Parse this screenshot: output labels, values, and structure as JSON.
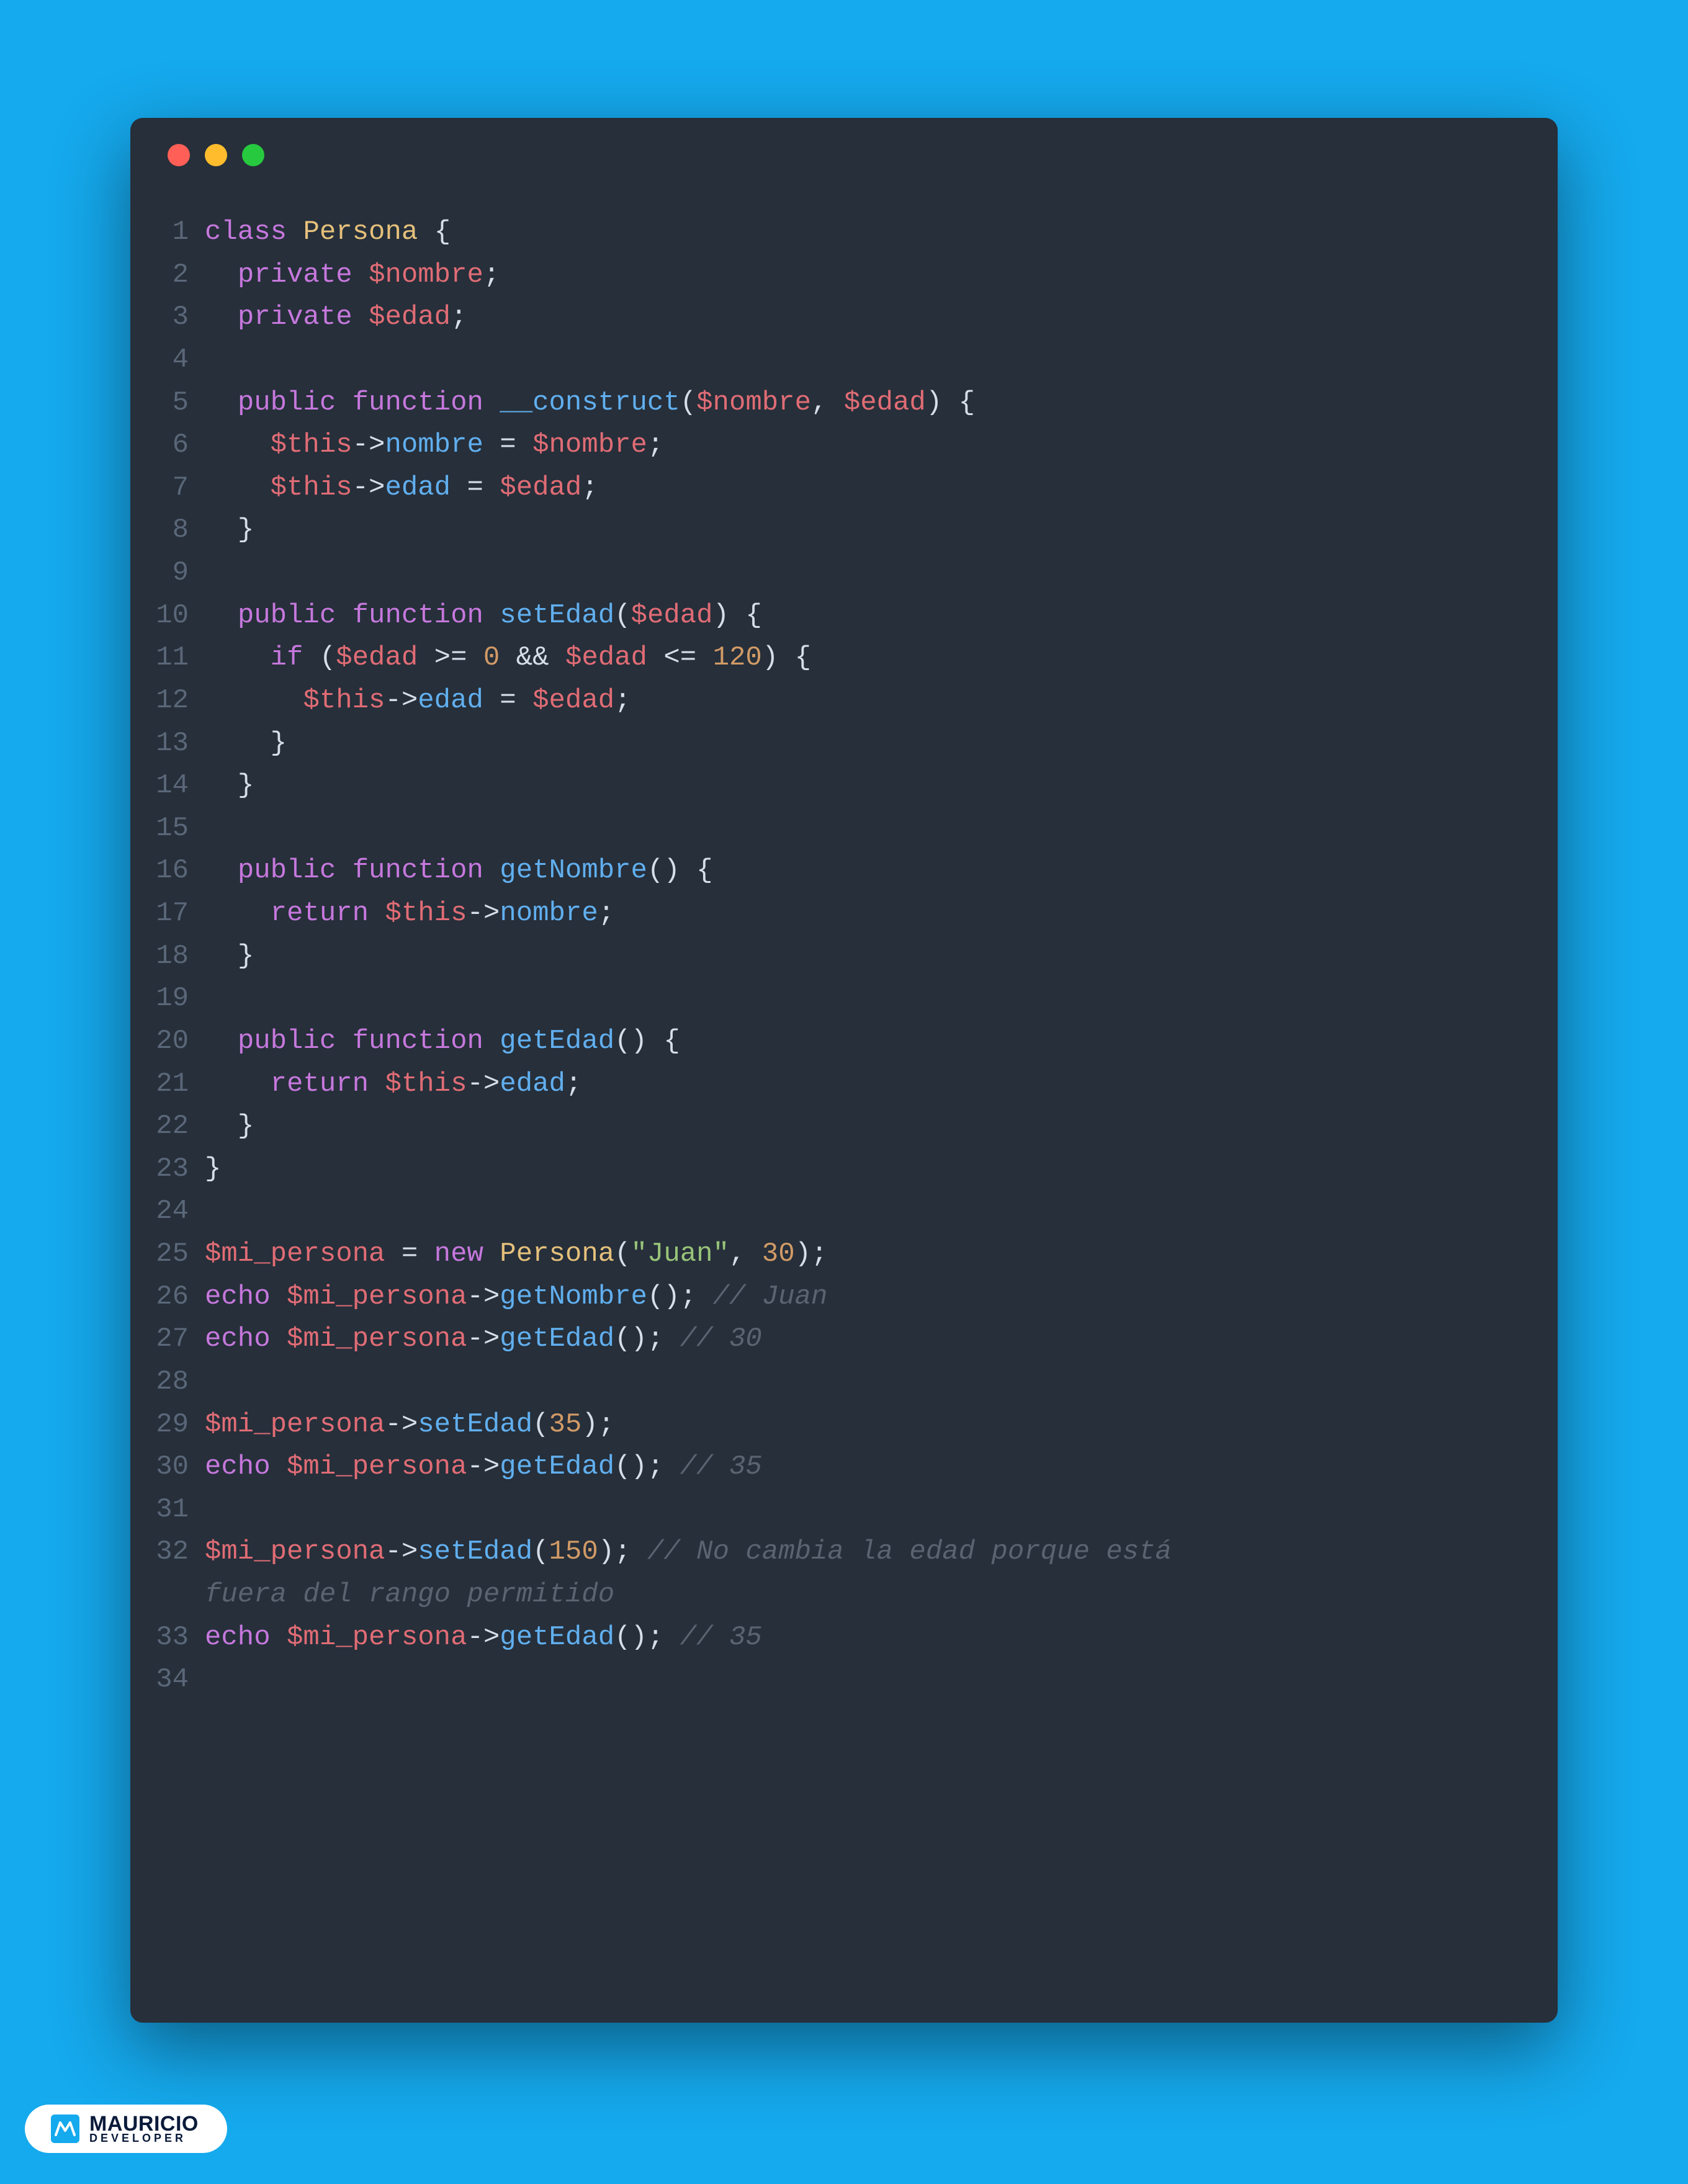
{
  "window": {
    "traffic_lights": [
      "red",
      "yellow",
      "green"
    ]
  },
  "badge": {
    "name_top": "MAURICIO",
    "name_bot": "DEVELOPER"
  },
  "code": {
    "language": "php",
    "lines": [
      {
        "n": "1",
        "tokens": [
          {
            "c": "kw",
            "t": "class"
          },
          {
            "c": "op",
            "t": " "
          },
          {
            "c": "cls",
            "t": "Persona"
          },
          {
            "c": "op",
            "t": " "
          },
          {
            "c": "pun",
            "t": "{"
          }
        ]
      },
      {
        "n": "2",
        "tokens": [
          {
            "c": "op",
            "t": "  "
          },
          {
            "c": "kw",
            "t": "private"
          },
          {
            "c": "op",
            "t": " "
          },
          {
            "c": "var",
            "t": "$nombre"
          },
          {
            "c": "pun",
            "t": ";"
          }
        ]
      },
      {
        "n": "3",
        "tokens": [
          {
            "c": "op",
            "t": "  "
          },
          {
            "c": "kw",
            "t": "private"
          },
          {
            "c": "op",
            "t": " "
          },
          {
            "c": "var",
            "t": "$edad"
          },
          {
            "c": "pun",
            "t": ";"
          }
        ]
      },
      {
        "n": "4",
        "tokens": []
      },
      {
        "n": "5",
        "tokens": [
          {
            "c": "op",
            "t": "  "
          },
          {
            "c": "kw",
            "t": "public"
          },
          {
            "c": "op",
            "t": " "
          },
          {
            "c": "kw",
            "t": "function"
          },
          {
            "c": "op",
            "t": " "
          },
          {
            "c": "fn",
            "t": "__construct"
          },
          {
            "c": "pun",
            "t": "("
          },
          {
            "c": "var",
            "t": "$nombre"
          },
          {
            "c": "pun",
            "t": ","
          },
          {
            "c": "op",
            "t": " "
          },
          {
            "c": "var",
            "t": "$edad"
          },
          {
            "c": "pun",
            "t": ")"
          },
          {
            "c": "op",
            "t": " "
          },
          {
            "c": "pun",
            "t": "{"
          }
        ]
      },
      {
        "n": "6",
        "tokens": [
          {
            "c": "op",
            "t": "    "
          },
          {
            "c": "th",
            "t": "$this"
          },
          {
            "c": "op",
            "t": "->"
          },
          {
            "c": "prop",
            "t": "nombre"
          },
          {
            "c": "op",
            "t": " = "
          },
          {
            "c": "var",
            "t": "$nombre"
          },
          {
            "c": "pun",
            "t": ";"
          }
        ]
      },
      {
        "n": "7",
        "tokens": [
          {
            "c": "op",
            "t": "    "
          },
          {
            "c": "th",
            "t": "$this"
          },
          {
            "c": "op",
            "t": "->"
          },
          {
            "c": "prop",
            "t": "edad"
          },
          {
            "c": "op",
            "t": " = "
          },
          {
            "c": "var",
            "t": "$edad"
          },
          {
            "c": "pun",
            "t": ";"
          }
        ]
      },
      {
        "n": "8",
        "tokens": [
          {
            "c": "op",
            "t": "  "
          },
          {
            "c": "pun",
            "t": "}"
          }
        ]
      },
      {
        "n": "9",
        "tokens": []
      },
      {
        "n": "10",
        "tokens": [
          {
            "c": "op",
            "t": "  "
          },
          {
            "c": "kw",
            "t": "public"
          },
          {
            "c": "op",
            "t": " "
          },
          {
            "c": "kw",
            "t": "function"
          },
          {
            "c": "op",
            "t": " "
          },
          {
            "c": "fn",
            "t": "setEdad"
          },
          {
            "c": "pun",
            "t": "("
          },
          {
            "c": "var",
            "t": "$edad"
          },
          {
            "c": "pun",
            "t": ")"
          },
          {
            "c": "op",
            "t": " "
          },
          {
            "c": "pun",
            "t": "{"
          }
        ]
      },
      {
        "n": "11",
        "tokens": [
          {
            "c": "op",
            "t": "    "
          },
          {
            "c": "kw",
            "t": "if"
          },
          {
            "c": "op",
            "t": " "
          },
          {
            "c": "pun",
            "t": "("
          },
          {
            "c": "var",
            "t": "$edad"
          },
          {
            "c": "op",
            "t": " >= "
          },
          {
            "c": "num",
            "t": "0"
          },
          {
            "c": "op",
            "t": " && "
          },
          {
            "c": "var",
            "t": "$edad"
          },
          {
            "c": "op",
            "t": " <= "
          },
          {
            "c": "num",
            "t": "120"
          },
          {
            "c": "pun",
            "t": ")"
          },
          {
            "c": "op",
            "t": " "
          },
          {
            "c": "pun",
            "t": "{"
          }
        ]
      },
      {
        "n": "12",
        "tokens": [
          {
            "c": "op",
            "t": "      "
          },
          {
            "c": "th",
            "t": "$this"
          },
          {
            "c": "op",
            "t": "->"
          },
          {
            "c": "prop",
            "t": "edad"
          },
          {
            "c": "op",
            "t": " = "
          },
          {
            "c": "var",
            "t": "$edad"
          },
          {
            "c": "pun",
            "t": ";"
          }
        ]
      },
      {
        "n": "13",
        "tokens": [
          {
            "c": "op",
            "t": "    "
          },
          {
            "c": "pun",
            "t": "}"
          }
        ]
      },
      {
        "n": "14",
        "tokens": [
          {
            "c": "op",
            "t": "  "
          },
          {
            "c": "pun",
            "t": "}"
          }
        ]
      },
      {
        "n": "15",
        "tokens": []
      },
      {
        "n": "16",
        "tokens": [
          {
            "c": "op",
            "t": "  "
          },
          {
            "c": "kw",
            "t": "public"
          },
          {
            "c": "op",
            "t": " "
          },
          {
            "c": "kw",
            "t": "function"
          },
          {
            "c": "op",
            "t": " "
          },
          {
            "c": "fn",
            "t": "getNombre"
          },
          {
            "c": "pun",
            "t": "()"
          },
          {
            "c": "op",
            "t": " "
          },
          {
            "c": "pun",
            "t": "{"
          }
        ]
      },
      {
        "n": "17",
        "tokens": [
          {
            "c": "op",
            "t": "    "
          },
          {
            "c": "kw",
            "t": "return"
          },
          {
            "c": "op",
            "t": " "
          },
          {
            "c": "th",
            "t": "$this"
          },
          {
            "c": "op",
            "t": "->"
          },
          {
            "c": "prop",
            "t": "nombre"
          },
          {
            "c": "pun",
            "t": ";"
          }
        ]
      },
      {
        "n": "18",
        "tokens": [
          {
            "c": "op",
            "t": "  "
          },
          {
            "c": "pun",
            "t": "}"
          }
        ]
      },
      {
        "n": "19",
        "tokens": []
      },
      {
        "n": "20",
        "tokens": [
          {
            "c": "op",
            "t": "  "
          },
          {
            "c": "kw",
            "t": "public"
          },
          {
            "c": "op",
            "t": " "
          },
          {
            "c": "kw",
            "t": "function"
          },
          {
            "c": "op",
            "t": " "
          },
          {
            "c": "fn",
            "t": "getEdad"
          },
          {
            "c": "pun",
            "t": "()"
          },
          {
            "c": "op",
            "t": " "
          },
          {
            "c": "pun",
            "t": "{"
          }
        ]
      },
      {
        "n": "21",
        "tokens": [
          {
            "c": "op",
            "t": "    "
          },
          {
            "c": "kw",
            "t": "return"
          },
          {
            "c": "op",
            "t": " "
          },
          {
            "c": "th",
            "t": "$this"
          },
          {
            "c": "op",
            "t": "->"
          },
          {
            "c": "prop",
            "t": "edad"
          },
          {
            "c": "pun",
            "t": ";"
          }
        ]
      },
      {
        "n": "22",
        "tokens": [
          {
            "c": "op",
            "t": "  "
          },
          {
            "c": "pun",
            "t": "}"
          }
        ]
      },
      {
        "n": "23",
        "tokens": [
          {
            "c": "pun",
            "t": "}"
          }
        ]
      },
      {
        "n": "24",
        "tokens": []
      },
      {
        "n": "25",
        "tokens": [
          {
            "c": "var",
            "t": "$mi_persona"
          },
          {
            "c": "op",
            "t": " = "
          },
          {
            "c": "kw",
            "t": "new"
          },
          {
            "c": "op",
            "t": " "
          },
          {
            "c": "cls",
            "t": "Persona"
          },
          {
            "c": "pun",
            "t": "("
          },
          {
            "c": "str",
            "t": "\"Juan\""
          },
          {
            "c": "pun",
            "t": ","
          },
          {
            "c": "op",
            "t": " "
          },
          {
            "c": "num",
            "t": "30"
          },
          {
            "c": "pun",
            "t": ");"
          }
        ]
      },
      {
        "n": "26",
        "tokens": [
          {
            "c": "kw",
            "t": "echo"
          },
          {
            "c": "op",
            "t": " "
          },
          {
            "c": "var",
            "t": "$mi_persona"
          },
          {
            "c": "op",
            "t": "->"
          },
          {
            "c": "fn",
            "t": "getNombre"
          },
          {
            "c": "pun",
            "t": "();"
          },
          {
            "c": "op",
            "t": " "
          },
          {
            "c": "cmt",
            "t": "// Juan"
          }
        ]
      },
      {
        "n": "27",
        "tokens": [
          {
            "c": "kw",
            "t": "echo"
          },
          {
            "c": "op",
            "t": " "
          },
          {
            "c": "var",
            "t": "$mi_persona"
          },
          {
            "c": "op",
            "t": "->"
          },
          {
            "c": "fn",
            "t": "getEdad"
          },
          {
            "c": "pun",
            "t": "();"
          },
          {
            "c": "op",
            "t": " "
          },
          {
            "c": "cmt",
            "t": "// 30"
          }
        ]
      },
      {
        "n": "28",
        "tokens": []
      },
      {
        "n": "29",
        "tokens": [
          {
            "c": "var",
            "t": "$mi_persona"
          },
          {
            "c": "op",
            "t": "->"
          },
          {
            "c": "fn",
            "t": "setEdad"
          },
          {
            "c": "pun",
            "t": "("
          },
          {
            "c": "num",
            "t": "35"
          },
          {
            "c": "pun",
            "t": ");"
          }
        ]
      },
      {
        "n": "30",
        "tokens": [
          {
            "c": "kw",
            "t": "echo"
          },
          {
            "c": "op",
            "t": " "
          },
          {
            "c": "var",
            "t": "$mi_persona"
          },
          {
            "c": "op",
            "t": "->"
          },
          {
            "c": "fn",
            "t": "getEdad"
          },
          {
            "c": "pun",
            "t": "();"
          },
          {
            "c": "op",
            "t": " "
          },
          {
            "c": "cmt",
            "t": "// 35"
          }
        ]
      },
      {
        "n": "31",
        "tokens": []
      },
      {
        "n": "32",
        "tokens": [
          {
            "c": "var",
            "t": "$mi_persona"
          },
          {
            "c": "op",
            "t": "->"
          },
          {
            "c": "fn",
            "t": "setEdad"
          },
          {
            "c": "pun",
            "t": "("
          },
          {
            "c": "num",
            "t": "150"
          },
          {
            "c": "pun",
            "t": ");"
          },
          {
            "c": "op",
            "t": " "
          },
          {
            "c": "cmt",
            "t": "// No cambia la edad porque está"
          }
        ]
      },
      {
        "n": "",
        "wrap": true,
        "tokens": [
          {
            "c": "cmt",
            "t": "fuera del rango permitido"
          }
        ]
      },
      {
        "n": "33",
        "tokens": [
          {
            "c": "kw",
            "t": "echo"
          },
          {
            "c": "op",
            "t": " "
          },
          {
            "c": "var",
            "t": "$mi_persona"
          },
          {
            "c": "op",
            "t": "->"
          },
          {
            "c": "fn",
            "t": "getEdad"
          },
          {
            "c": "pun",
            "t": "();"
          },
          {
            "c": "op",
            "t": " "
          },
          {
            "c": "cmt",
            "t": "// 35"
          }
        ]
      },
      {
        "n": "34",
        "tokens": []
      }
    ]
  }
}
